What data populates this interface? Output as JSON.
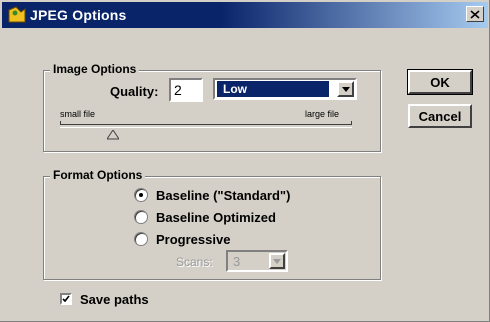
{
  "window": {
    "title": "JPEG Options"
  },
  "image_options": {
    "legend": "Image Options",
    "quality_label": "Quality:",
    "quality_value": "2",
    "preset_value": "Low",
    "slider_min_label": "small file",
    "slider_max_label": "large file",
    "slider_fraction": 0.18
  },
  "format_options": {
    "legend": "Format Options",
    "radios": [
      {
        "label": "Baseline (\"Standard\")",
        "selected": true
      },
      {
        "label": "Baseline Optimized",
        "selected": false
      },
      {
        "label": "Progressive",
        "selected": false
      }
    ],
    "scans_label": "Scans:",
    "scans_value": "3"
  },
  "buttons": {
    "ok_label": "OK",
    "cancel_label": "Cancel"
  },
  "save_paths": {
    "label": "Save paths",
    "checked": true
  },
  "colors": {
    "title_bar": "#0a246a",
    "dialog_bg": "#d4d0c8",
    "selection": "#0a246a"
  }
}
